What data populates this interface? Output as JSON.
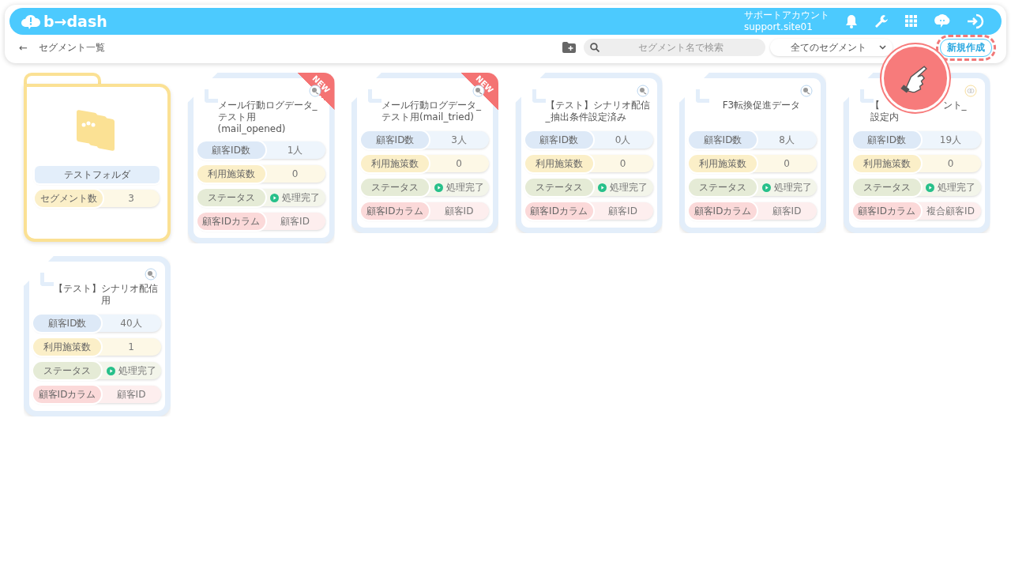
{
  "header": {
    "logo": "b→dash",
    "account_name": "サポートアカウント",
    "account_id": "support.site01"
  },
  "toolbar": {
    "back": "←",
    "title": "セグメント一覧",
    "search": {
      "placeholder": "セグメント名で検索"
    },
    "filter": "全てのセグメント",
    "create_button": {
      "label": "新規作成",
      "highlighted": true
    }
  },
  "folders": [
    {
      "name": "テストフォルダ",
      "count_label": "セグメント数",
      "count": "3"
    }
  ],
  "segments": [
    {
      "title_parts": [
        "メール行動ログデータ_テスト用(mail_opened)"
      ],
      "new": true,
      "new_label": "NEW",
      "linked": false,
      "rows": [
        {
          "kind": "ids",
          "label": "顧客ID数",
          "value": "1人"
        },
        {
          "kind": "measures",
          "label": "利用施策数",
          "value": "0"
        },
        {
          "kind": "status",
          "label": "ステータス",
          "value": "処理完了"
        },
        {
          "kind": "column",
          "label": "顧客IDカラム",
          "value": "顧客ID"
        }
      ]
    },
    {
      "title_parts": [
        "メール行動ログデータ_テスト用(mail_tried)"
      ],
      "new": true,
      "new_label": "NEW",
      "linked": false,
      "rows": [
        {
          "kind": "ids",
          "label": "顧客ID数",
          "value": "3人"
        },
        {
          "kind": "measures",
          "label": "利用施策数",
          "value": "0"
        },
        {
          "kind": "status",
          "label": "ステータス",
          "value": "処理完了"
        },
        {
          "kind": "column",
          "label": "顧客IDカラム",
          "value": "顧客ID"
        }
      ]
    },
    {
      "title_parts": [
        "【テスト】シナリオ配信_抽出条件設定済み"
      ],
      "new": false,
      "linked": false,
      "rows": [
        {
          "kind": "ids",
          "label": "顧客ID数",
          "value": "0人"
        },
        {
          "kind": "measures",
          "label": "利用施策数",
          "value": "0"
        },
        {
          "kind": "status",
          "label": "ステータス",
          "value": "処理完了"
        },
        {
          "kind": "column",
          "label": "顧客IDカラム",
          "value": "顧客ID"
        }
      ]
    },
    {
      "title_parts": [
        "F3転換促進データ"
      ],
      "new": false,
      "linked": false,
      "rows": [
        {
          "kind": "ids",
          "label": "顧客ID数",
          "value": "8人"
        },
        {
          "kind": "measures",
          "label": "利用施策数",
          "value": "0"
        },
        {
          "kind": "status",
          "label": "ステータス",
          "value": "処理完了"
        },
        {
          "kind": "column",
          "label": "顧客IDカラム",
          "value": "顧客ID"
        }
      ]
    },
    {
      "title_parts": [
        "【",
        "ント_",
        "設定内"
      ],
      "new": false,
      "linked": true,
      "rows": [
        {
          "kind": "ids",
          "label": "顧客ID数",
          "value": "19人"
        },
        {
          "kind": "measures",
          "label": "利用施策数",
          "value": "0"
        },
        {
          "kind": "status",
          "label": "ステータス",
          "value": "処理完了"
        },
        {
          "kind": "column",
          "label": "顧客IDカラム",
          "value": "複合顧客ID"
        }
      ]
    },
    {
      "title_parts": [
        "【テスト】シナリオ配信用"
      ],
      "new": false,
      "linked": false,
      "rows": [
        {
          "kind": "ids",
          "label": "顧客ID数",
          "value": "40人"
        },
        {
          "kind": "measures",
          "label": "利用施策数",
          "value": "1"
        },
        {
          "kind": "status",
          "label": "ステータス",
          "value": "処理完了"
        },
        {
          "kind": "column",
          "label": "顧客IDカラム",
          "value": "顧客ID"
        }
      ]
    }
  ]
}
